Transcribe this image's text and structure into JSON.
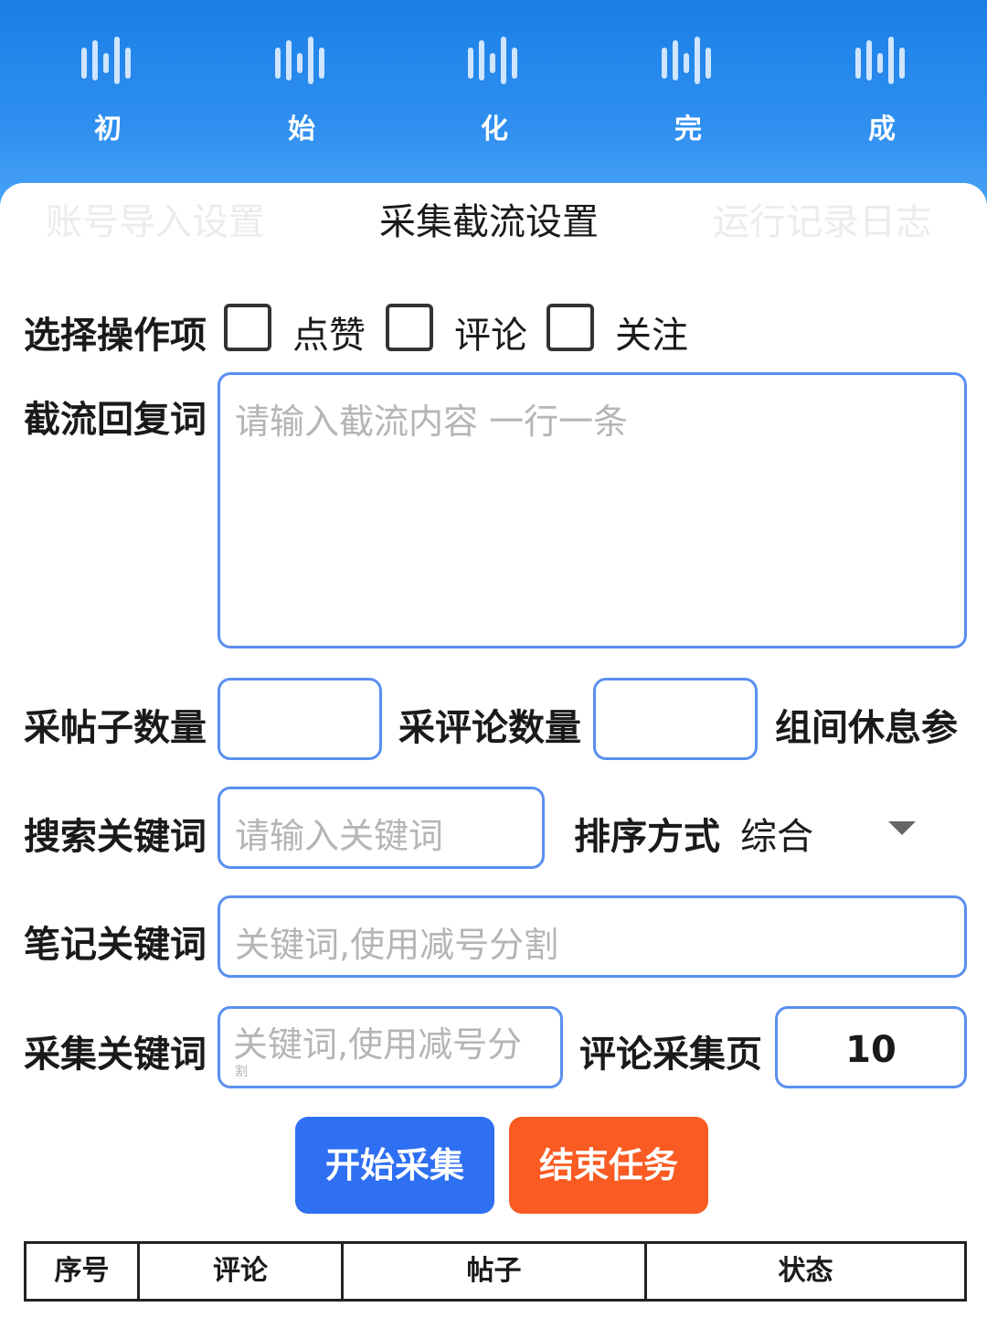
{
  "steps": [
    "初",
    "始",
    "化",
    "完",
    "成"
  ],
  "colors": {
    "header": "#2f8ff0",
    "border": "#5a8ff0",
    "start": "#2f6ff2",
    "stop": "#f95b22"
  },
  "tabs": {
    "import": "账号导入设置",
    "collect": "采集截流设置",
    "log": "运行记录日志"
  },
  "operation": {
    "label": "选择操作项",
    "like": "点赞",
    "comment": "评论",
    "follow": "关注"
  },
  "reply": {
    "label": "截流回复词",
    "placeholder": "请输入截流内容 一行一条"
  },
  "counts": {
    "post_label": "采帖子数量",
    "post_value": "",
    "comment_label": "采评论数量",
    "comment_value": "",
    "rest_label": "组间休息参"
  },
  "search": {
    "label": "搜索关键词",
    "placeholder": "请输入关键词",
    "sort_label": "排序方式",
    "sort_value": "综合"
  },
  "note": {
    "label": "笔记关键词",
    "placeholder": "关键词,使用减号分割"
  },
  "collect": {
    "label": "采集关键词",
    "placeholder": "关键词,使用减号分",
    "placeholder_tail": "割",
    "page_label": "评论采集页",
    "page_value": "10"
  },
  "buttons": {
    "start": "开始采集",
    "stop": "结束任务"
  },
  "table": {
    "columns": [
      "序号",
      "评论",
      "帖子",
      "状态"
    ]
  }
}
